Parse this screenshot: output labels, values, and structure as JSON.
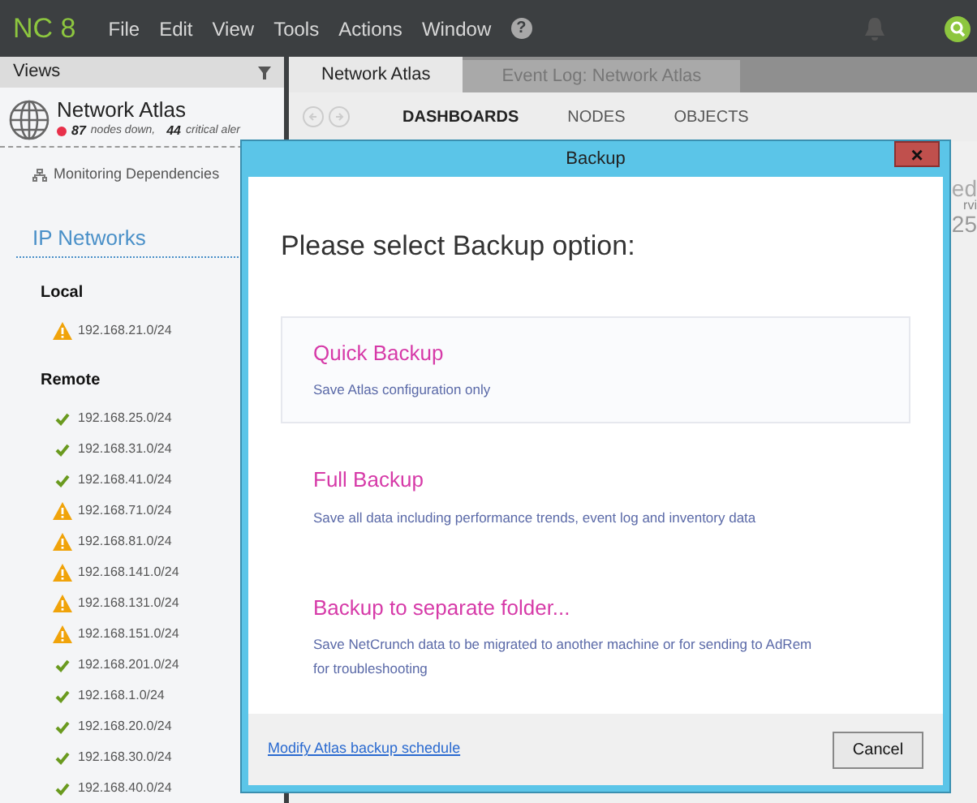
{
  "app": {
    "logo": "NC 8",
    "menu": [
      "File",
      "Edit",
      "View",
      "Tools",
      "Actions",
      "Window"
    ],
    "help": "?"
  },
  "sidebar": {
    "header": "Views",
    "atlas": {
      "title": "Network Atlas",
      "nodes_count": "87",
      "nodes_label": "nodes down,",
      "alerts_count": "44",
      "alerts_label": "critical aler"
    },
    "dependencies": "Monitoring Dependencies",
    "section": "IP Networks",
    "groups": [
      {
        "title": "Local",
        "items": [
          {
            "label": "192.168.21.0/24",
            "kind": "warning"
          }
        ]
      },
      {
        "title": "Remote",
        "items": [
          {
            "label": "192.168.25.0/24",
            "kind": "ok"
          },
          {
            "label": "192.168.31.0/24",
            "kind": "ok"
          },
          {
            "label": "192.168.41.0/24",
            "kind": "ok"
          },
          {
            "label": "192.168.71.0/24",
            "kind": "warning"
          },
          {
            "label": "192.168.81.0/24",
            "kind": "warning"
          },
          {
            "label": "192.168.141.0/24",
            "kind": "warning"
          },
          {
            "label": "192.168.131.0/24",
            "kind": "warning"
          },
          {
            "label": "192.168.151.0/24",
            "kind": "warning"
          },
          {
            "label": "192.168.201.0/24",
            "kind": "ok"
          },
          {
            "label": "192.168.1.0/24",
            "kind": "ok"
          },
          {
            "label": "192.168.20.0/24",
            "kind": "ok"
          },
          {
            "label": "192.168.30.0/24",
            "kind": "ok"
          },
          {
            "label": "192.168.40.0/24",
            "kind": "ok"
          }
        ]
      }
    ]
  },
  "tabs": [
    {
      "label": "Network Atlas",
      "selected": true
    },
    {
      "label": "Event Log: Network Atlas",
      "selected": false
    }
  ],
  "nav": [
    {
      "label": "DASHBOARDS",
      "selected": true
    },
    {
      "label": "NODES",
      "selected": false
    },
    {
      "label": "OBJECTS",
      "selected": false
    }
  ],
  "background_fragments": [
    "ed",
    "rvi",
    "25"
  ],
  "dialog": {
    "title": "Backup",
    "close": "×",
    "heading": "Please select Backup option:",
    "options": [
      {
        "title": "Quick Backup",
        "description": "Save Atlas configuration only",
        "selected": true
      },
      {
        "title": "Full Backup",
        "description": "Save all data including performance trends, event log and inventory data",
        "selected": false
      },
      {
        "title": "Backup to separate folder...",
        "description": "Save NetCrunch data to be migrated to another machine or for sending to AdRem for troubleshooting",
        "selected": false
      }
    ],
    "link": "Modify Atlas backup schedule",
    "cancel": "Cancel"
  }
}
